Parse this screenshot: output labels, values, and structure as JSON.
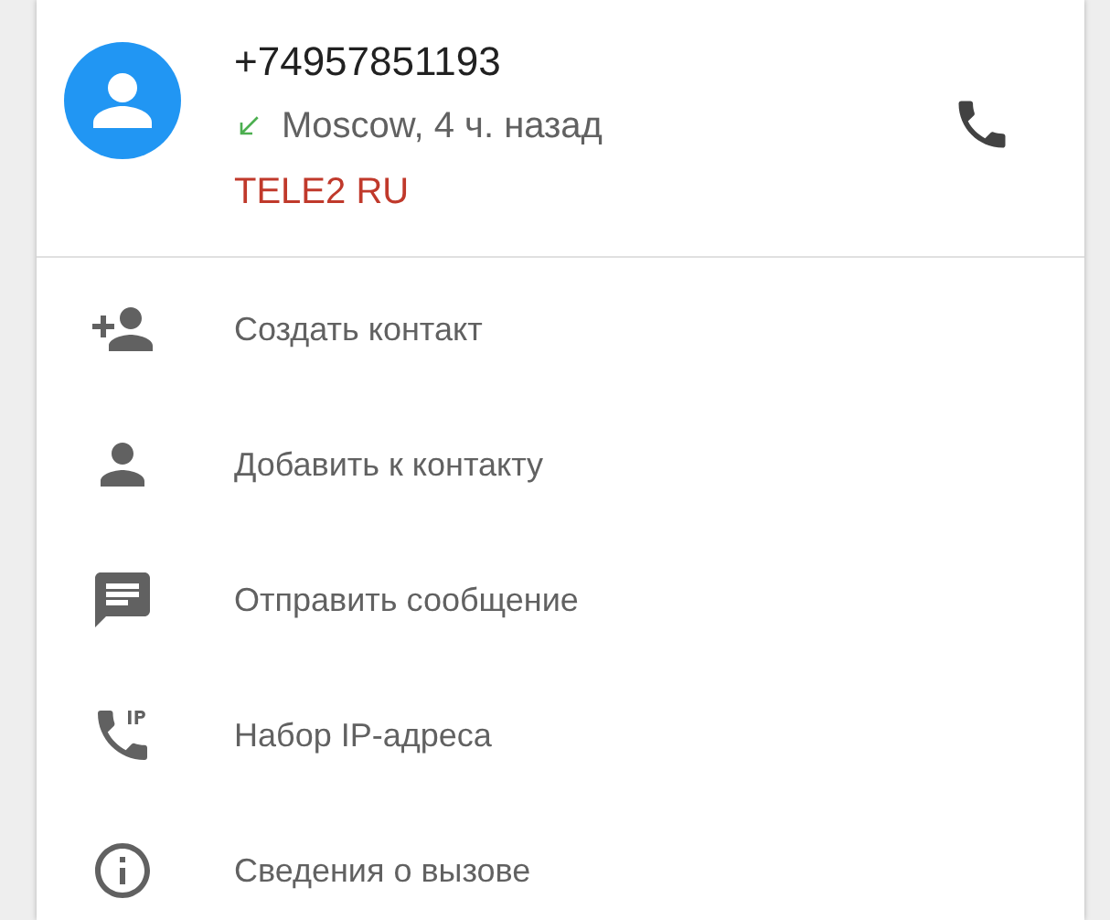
{
  "call": {
    "number": "+74957851193",
    "kind": "incoming",
    "details": "Moscow, 4 ч. назад",
    "carrier": "TELE2 RU"
  },
  "actions": [
    {
      "kind": "add-contact",
      "label": "Создать контакт"
    },
    {
      "kind": "person",
      "label": "Добавить к контакту"
    },
    {
      "kind": "message",
      "label": "Отправить сообщение"
    },
    {
      "kind": "ip-call",
      "label": "Набор IP-адреса"
    },
    {
      "kind": "info",
      "label": "Сведения о вызове"
    }
  ]
}
